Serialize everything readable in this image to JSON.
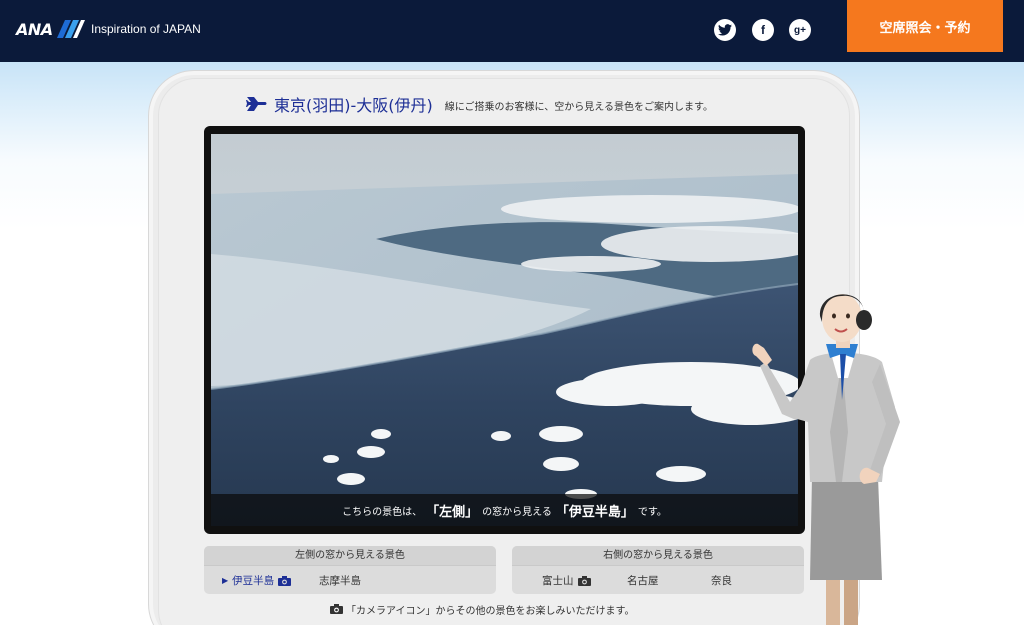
{
  "header": {
    "logo_text": "ANA",
    "tagline": "Inspiration of JAPAN",
    "social": [
      {
        "name": "twitter-icon",
        "glyph": "t"
      },
      {
        "name": "facebook-icon",
        "glyph": "f"
      },
      {
        "name": "google-plus-icon",
        "glyph": "g+"
      }
    ],
    "book_button": "空席照会・予約"
  },
  "route": {
    "name": "東京(羽田)-大阪(伊丹)",
    "description": "線にご搭乗のお客様に、空から見える景色をご案内します。"
  },
  "photo": {
    "caption_pre": "こちらの景色は、",
    "caption_side": "「左側」",
    "caption_mid": "の窓から見える",
    "caption_place": "「伊豆半島」",
    "caption_post": "です。"
  },
  "left_list": {
    "title": "左側の窓から見える景色",
    "items": [
      {
        "label": "伊豆半島",
        "active": true,
        "camera": true
      },
      {
        "label": "志摩半島",
        "active": false,
        "camera": false
      }
    ]
  },
  "right_list": {
    "title": "右側の窓から見える景色",
    "items": [
      {
        "label": "富士山",
        "active": false,
        "camera": true
      },
      {
        "label": "名古屋",
        "active": false,
        "camera": false
      },
      {
        "label": "奈良",
        "active": false,
        "camera": false
      }
    ]
  },
  "footnote": "「カメラアイコン」からその他の景色をお楽しみいただけます。",
  "colors": {
    "header_bg": "#0b1a3a",
    "accent_orange": "#f5781e",
    "route_blue": "#1d2f96"
  }
}
